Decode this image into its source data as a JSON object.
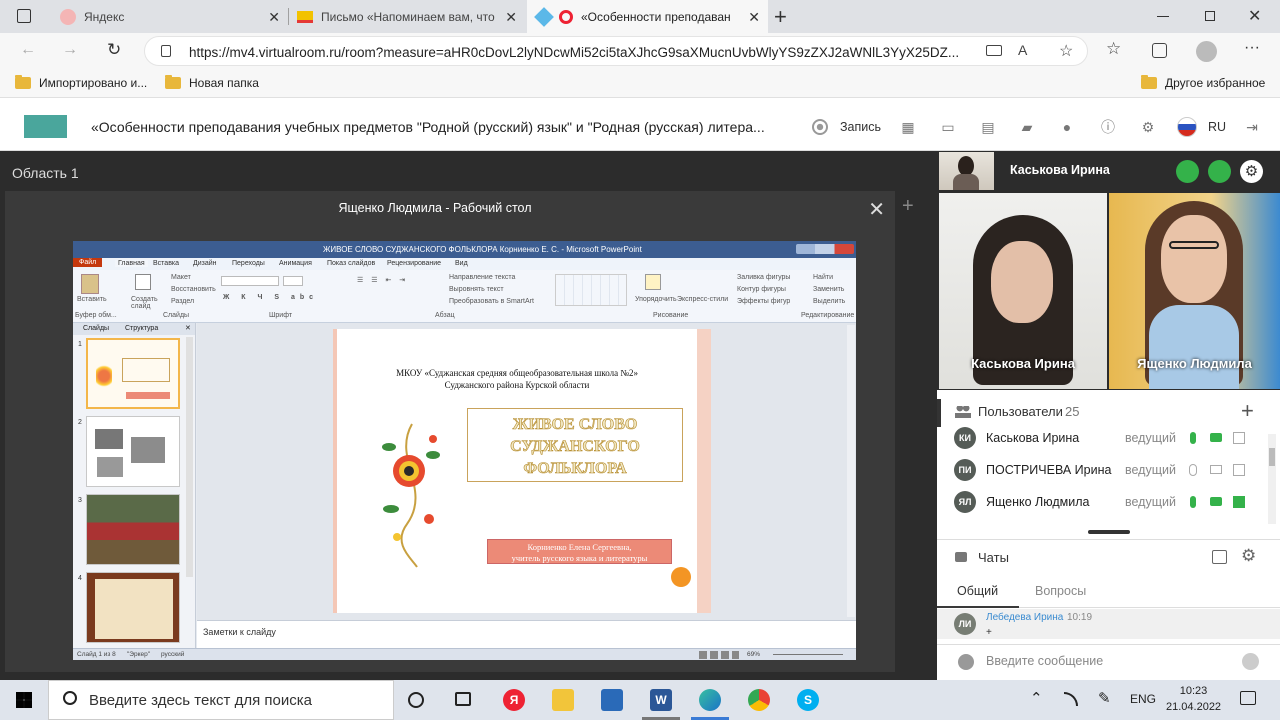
{
  "browser": {
    "tabs": [
      {
        "title": "Яндекс",
        "icon": "yandex-icon"
      },
      {
        "title": "Письмо «Напоминаем вам, что",
        "icon": "mail-icon"
      },
      {
        "title": "«Особенности преподаван",
        "icon": "virtualroom-icon"
      }
    ],
    "url": "https://mv4.virtualroom.ru/room?measure=aHR0cDovL2lyNDcwMi52ci5taXJhcG9saXMucnUvbWlyYS9zZXJ2aWNlL3YyX25DZ...",
    "bookmarks": [
      {
        "label": "Импортировано и..."
      },
      {
        "label": "Новая папка"
      },
      {
        "label": "Другое избранное"
      }
    ]
  },
  "app": {
    "title": "«Особенности преподавания учебных предметов \"Родной (русский) язык\" и \"Родная (русская) литера...",
    "record_label": "Запись",
    "lang": "RU"
  },
  "stage": {
    "area_title": "Область 1",
    "share_title": "Ященко Людмила - Рабочий стол"
  },
  "powerpoint": {
    "window_title": "ЖИВОЕ СЛОВО СУДЖАНСКОГО ФОЛЬКЛОРА Корниенко Е. С. - Microsoft PowerPoint",
    "menu": [
      "Файл",
      "Главная",
      "Вставка",
      "Дизайн",
      "Переходы",
      "Анимация",
      "Показ слайдов",
      "Рецензирование",
      "Вид"
    ],
    "ribbon_groups": [
      "Буфер обм...",
      "Слайды",
      "Шрифт",
      "Абзац",
      "Рисование",
      "Редактирование"
    ],
    "ribbon_buttons": [
      "Вставить",
      "Создать слайд",
      "Макет",
      "Восстановить",
      "Раздел",
      "Упорядочить",
      "Экспресс-стили",
      "Найти",
      "Заменить",
      "Выделить",
      "Заливка фигуры",
      "Контур фигуры",
      "Эффекты фигур",
      "Направление текста",
      "Выровнять текст",
      "Преобразовать в SmartArt"
    ],
    "panel_tabs": [
      "Слайды",
      "Структура"
    ],
    "thumb_numbers": [
      "1",
      "2",
      "3",
      "4"
    ],
    "slide": {
      "school_line1": "МКОУ «Суджанская средняя общеобразовательная школа №2»",
      "school_line2": "Суджанского района Курской области",
      "title_lines": [
        "ЖИВОЕ СЛОВО",
        "СУДЖАНСКОГО",
        "ФОЛЬКЛОРА"
      ],
      "author_line1": "Корниенко Елена Сергеевна,",
      "author_line2": "учитель русского языка и литературы"
    },
    "notes_placeholder": "Заметки к слайду",
    "status": {
      "slide": "Слайд 1 из 8",
      "theme": "\"Эркер\"",
      "lang": "русский",
      "zoom": "69%"
    }
  },
  "participants": {
    "speaker": "Каськова Ирина",
    "videos": [
      {
        "name": "Каськова Ирина"
      },
      {
        "name": "Ященко Людмила"
      }
    ],
    "users_title": "Пользователи",
    "users_count": "25",
    "users": [
      {
        "initials": "КИ",
        "name": "Каськова Ирина",
        "role": "ведущий",
        "mic": "on",
        "cam": "on"
      },
      {
        "initials": "ПИ",
        "name": "ПОСТРИЧЕВА Ирина",
        "role": "ведущий",
        "mic": "off",
        "cam": "off"
      },
      {
        "initials": "ЯЛ",
        "name": "Ященко Людмила",
        "role": "ведущий",
        "mic": "on",
        "cam": "on"
      }
    ]
  },
  "chats": {
    "title": "Чаты",
    "tabs": [
      "Общий",
      "Вопросы"
    ],
    "message": {
      "initials": "ЛИ",
      "author": "Лебедева Ирина",
      "time": "10:19",
      "text": "+"
    },
    "input_placeholder": "Введите сообщение"
  },
  "taskbar": {
    "search_placeholder": "Введите здесь текст для поиска",
    "lang": "ENG",
    "time": "10:23",
    "date": "21.04.2022"
  },
  "colors": {
    "accent_green": "#34b24a",
    "stage_bg": "#2c2c2c",
    "ppt_blue": "#3c5d91"
  }
}
